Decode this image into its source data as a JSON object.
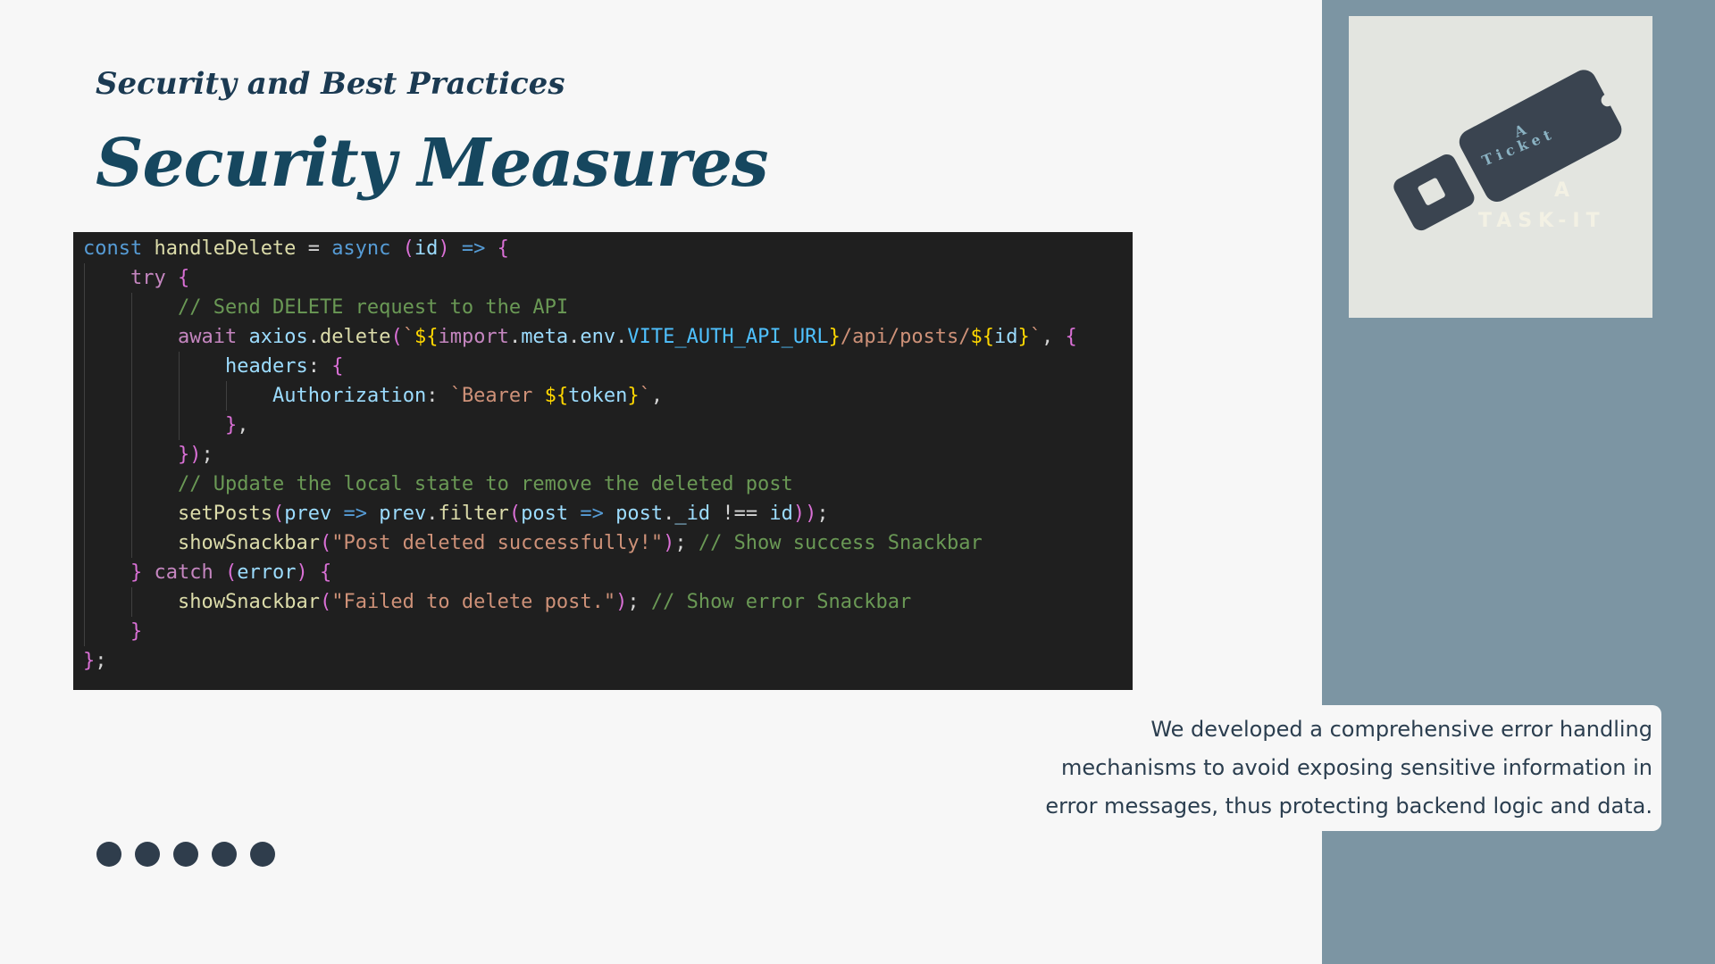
{
  "slide": {
    "subtitle": "Security and Best Practices",
    "title": "Security Measures",
    "description": "We developed a comprehensive error handling mechanisms to avoid exposing sensitive information in error messages, thus protecting backend logic and data.",
    "pagination_dots": 5
  },
  "logo": {
    "ticket_text_1": "A",
    "ticket_text_2": "Ticket",
    "brand_text_1": "A",
    "brand_text_2": "TASK-IT"
  },
  "code": {
    "language": "javascript",
    "lines": [
      "const handleDelete = async (id) => {",
      "    try {",
      "        // Send DELETE request to the API",
      "        await axios.delete(`${import.meta.env.VITE_AUTH_API_URL}/api/posts/${id}`, {",
      "            headers: {",
      "                Authorization: `Bearer ${token}`,",
      "            },",
      "        });",
      "        // Update the local state to remove the deleted post",
      "        setPosts(prev => prev.filter(post => post._id !== id));",
      "        showSnackbar(\"Post deleted successfully!\"); // Show success Snackbar",
      "    } catch (error) {",
      "        showSnackbar(\"Failed to delete post.\"); // Show error Snackbar",
      "    }",
      "};"
    ]
  },
  "colors": {
    "background": "#f7f7f7",
    "side_panel": "#7c95a3",
    "title": "#16475f",
    "code_background": "#1f1f1f",
    "dots": "#2f3d4c"
  }
}
